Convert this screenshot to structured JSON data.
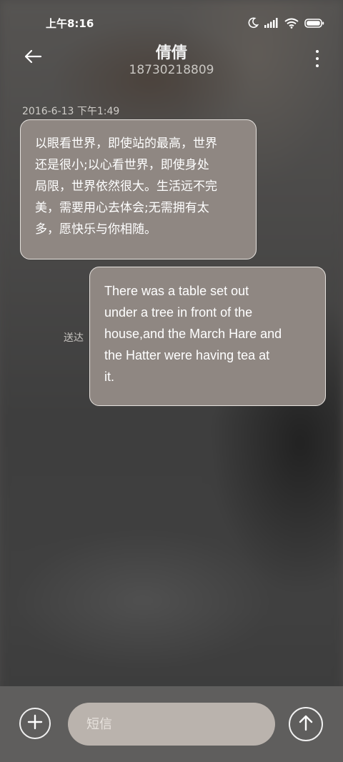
{
  "status_bar": {
    "time": "上午8:16",
    "icons": [
      "moon-icon",
      "signal-icon",
      "wifi-icon",
      "battery-icon"
    ]
  },
  "header": {
    "contact_name": "倩倩",
    "contact_number": "18730218809",
    "back_icon": "arrow-left-icon",
    "more_icon": "more-vertical-icon"
  },
  "conversation": {
    "timestamp": "2016-6-13 下午1:49",
    "messages": [
      {
        "direction": "incoming",
        "lines": [
          "以眼看世界，即使站的最高，世界",
          "还是很小;以心看世界，即使身处",
          "局限，世界依然很大。生活远不完",
          "美，需要用心去体会;无需拥有太",
          "多，愿快乐与你相随。"
        ]
      },
      {
        "direction": "outgoing",
        "status": "送达",
        "lines": [
          "There was a table set out",
          "under a tree in front of the",
          "house,and the March Hare and",
          "the Hatter were having tea at",
          "it."
        ]
      }
    ]
  },
  "composer": {
    "input_value": "",
    "input_placeholder": "短信",
    "attach_icon": "plus-icon",
    "send_icon": "arrow-up-icon"
  },
  "colors": {
    "bubble_fill": "#8f8782",
    "bubble_border": "#e6e2de",
    "composer_bg": "#5f5e5d",
    "input_bg": "#bab3ad"
  }
}
